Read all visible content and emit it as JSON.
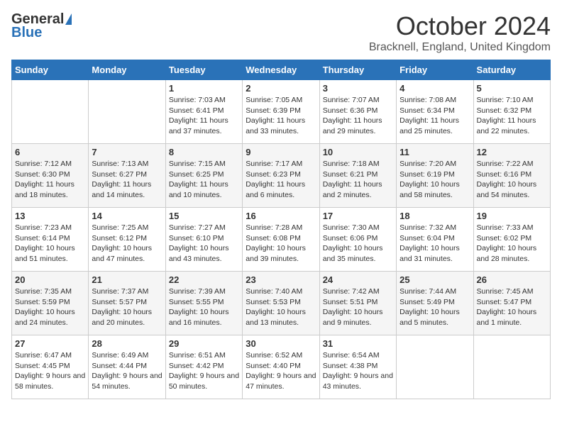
{
  "header": {
    "logo_general": "General",
    "logo_blue": "Blue",
    "month_title": "October 2024",
    "location": "Bracknell, England, United Kingdom"
  },
  "weekdays": [
    "Sunday",
    "Monday",
    "Tuesday",
    "Wednesday",
    "Thursday",
    "Friday",
    "Saturday"
  ],
  "weeks": [
    [
      {
        "day": "",
        "sunrise": "",
        "sunset": "",
        "daylight": ""
      },
      {
        "day": "",
        "sunrise": "",
        "sunset": "",
        "daylight": ""
      },
      {
        "day": "1",
        "sunrise": "Sunrise: 7:03 AM",
        "sunset": "Sunset: 6:41 PM",
        "daylight": "Daylight: 11 hours and 37 minutes."
      },
      {
        "day": "2",
        "sunrise": "Sunrise: 7:05 AM",
        "sunset": "Sunset: 6:39 PM",
        "daylight": "Daylight: 11 hours and 33 minutes."
      },
      {
        "day": "3",
        "sunrise": "Sunrise: 7:07 AM",
        "sunset": "Sunset: 6:36 PM",
        "daylight": "Daylight: 11 hours and 29 minutes."
      },
      {
        "day": "4",
        "sunrise": "Sunrise: 7:08 AM",
        "sunset": "Sunset: 6:34 PM",
        "daylight": "Daylight: 11 hours and 25 minutes."
      },
      {
        "day": "5",
        "sunrise": "Sunrise: 7:10 AM",
        "sunset": "Sunset: 6:32 PM",
        "daylight": "Daylight: 11 hours and 22 minutes."
      }
    ],
    [
      {
        "day": "6",
        "sunrise": "Sunrise: 7:12 AM",
        "sunset": "Sunset: 6:30 PM",
        "daylight": "Daylight: 11 hours and 18 minutes."
      },
      {
        "day": "7",
        "sunrise": "Sunrise: 7:13 AM",
        "sunset": "Sunset: 6:27 PM",
        "daylight": "Daylight: 11 hours and 14 minutes."
      },
      {
        "day": "8",
        "sunrise": "Sunrise: 7:15 AM",
        "sunset": "Sunset: 6:25 PM",
        "daylight": "Daylight: 11 hours and 10 minutes."
      },
      {
        "day": "9",
        "sunrise": "Sunrise: 7:17 AM",
        "sunset": "Sunset: 6:23 PM",
        "daylight": "Daylight: 11 hours and 6 minutes."
      },
      {
        "day": "10",
        "sunrise": "Sunrise: 7:18 AM",
        "sunset": "Sunset: 6:21 PM",
        "daylight": "Daylight: 11 hours and 2 minutes."
      },
      {
        "day": "11",
        "sunrise": "Sunrise: 7:20 AM",
        "sunset": "Sunset: 6:19 PM",
        "daylight": "Daylight: 10 hours and 58 minutes."
      },
      {
        "day": "12",
        "sunrise": "Sunrise: 7:22 AM",
        "sunset": "Sunset: 6:16 PM",
        "daylight": "Daylight: 10 hours and 54 minutes."
      }
    ],
    [
      {
        "day": "13",
        "sunrise": "Sunrise: 7:23 AM",
        "sunset": "Sunset: 6:14 PM",
        "daylight": "Daylight: 10 hours and 51 minutes."
      },
      {
        "day": "14",
        "sunrise": "Sunrise: 7:25 AM",
        "sunset": "Sunset: 6:12 PM",
        "daylight": "Daylight: 10 hours and 47 minutes."
      },
      {
        "day": "15",
        "sunrise": "Sunrise: 7:27 AM",
        "sunset": "Sunset: 6:10 PM",
        "daylight": "Daylight: 10 hours and 43 minutes."
      },
      {
        "day": "16",
        "sunrise": "Sunrise: 7:28 AM",
        "sunset": "Sunset: 6:08 PM",
        "daylight": "Daylight: 10 hours and 39 minutes."
      },
      {
        "day": "17",
        "sunrise": "Sunrise: 7:30 AM",
        "sunset": "Sunset: 6:06 PM",
        "daylight": "Daylight: 10 hours and 35 minutes."
      },
      {
        "day": "18",
        "sunrise": "Sunrise: 7:32 AM",
        "sunset": "Sunset: 6:04 PM",
        "daylight": "Daylight: 10 hours and 31 minutes."
      },
      {
        "day": "19",
        "sunrise": "Sunrise: 7:33 AM",
        "sunset": "Sunset: 6:02 PM",
        "daylight": "Daylight: 10 hours and 28 minutes."
      }
    ],
    [
      {
        "day": "20",
        "sunrise": "Sunrise: 7:35 AM",
        "sunset": "Sunset: 5:59 PM",
        "daylight": "Daylight: 10 hours and 24 minutes."
      },
      {
        "day": "21",
        "sunrise": "Sunrise: 7:37 AM",
        "sunset": "Sunset: 5:57 PM",
        "daylight": "Daylight: 10 hours and 20 minutes."
      },
      {
        "day": "22",
        "sunrise": "Sunrise: 7:39 AM",
        "sunset": "Sunset: 5:55 PM",
        "daylight": "Daylight: 10 hours and 16 minutes."
      },
      {
        "day": "23",
        "sunrise": "Sunrise: 7:40 AM",
        "sunset": "Sunset: 5:53 PM",
        "daylight": "Daylight: 10 hours and 13 minutes."
      },
      {
        "day": "24",
        "sunrise": "Sunrise: 7:42 AM",
        "sunset": "Sunset: 5:51 PM",
        "daylight": "Daylight: 10 hours and 9 minutes."
      },
      {
        "day": "25",
        "sunrise": "Sunrise: 7:44 AM",
        "sunset": "Sunset: 5:49 PM",
        "daylight": "Daylight: 10 hours and 5 minutes."
      },
      {
        "day": "26",
        "sunrise": "Sunrise: 7:45 AM",
        "sunset": "Sunset: 5:47 PM",
        "daylight": "Daylight: 10 hours and 1 minute."
      }
    ],
    [
      {
        "day": "27",
        "sunrise": "Sunrise: 6:47 AM",
        "sunset": "Sunset: 4:45 PM",
        "daylight": "Daylight: 9 hours and 58 minutes."
      },
      {
        "day": "28",
        "sunrise": "Sunrise: 6:49 AM",
        "sunset": "Sunset: 4:44 PM",
        "daylight": "Daylight: 9 hours and 54 minutes."
      },
      {
        "day": "29",
        "sunrise": "Sunrise: 6:51 AM",
        "sunset": "Sunset: 4:42 PM",
        "daylight": "Daylight: 9 hours and 50 minutes."
      },
      {
        "day": "30",
        "sunrise": "Sunrise: 6:52 AM",
        "sunset": "Sunset: 4:40 PM",
        "daylight": "Daylight: 9 hours and 47 minutes."
      },
      {
        "day": "31",
        "sunrise": "Sunrise: 6:54 AM",
        "sunset": "Sunset: 4:38 PM",
        "daylight": "Daylight: 9 hours and 43 minutes."
      },
      {
        "day": "",
        "sunrise": "",
        "sunset": "",
        "daylight": ""
      },
      {
        "day": "",
        "sunrise": "",
        "sunset": "",
        "daylight": ""
      }
    ]
  ]
}
